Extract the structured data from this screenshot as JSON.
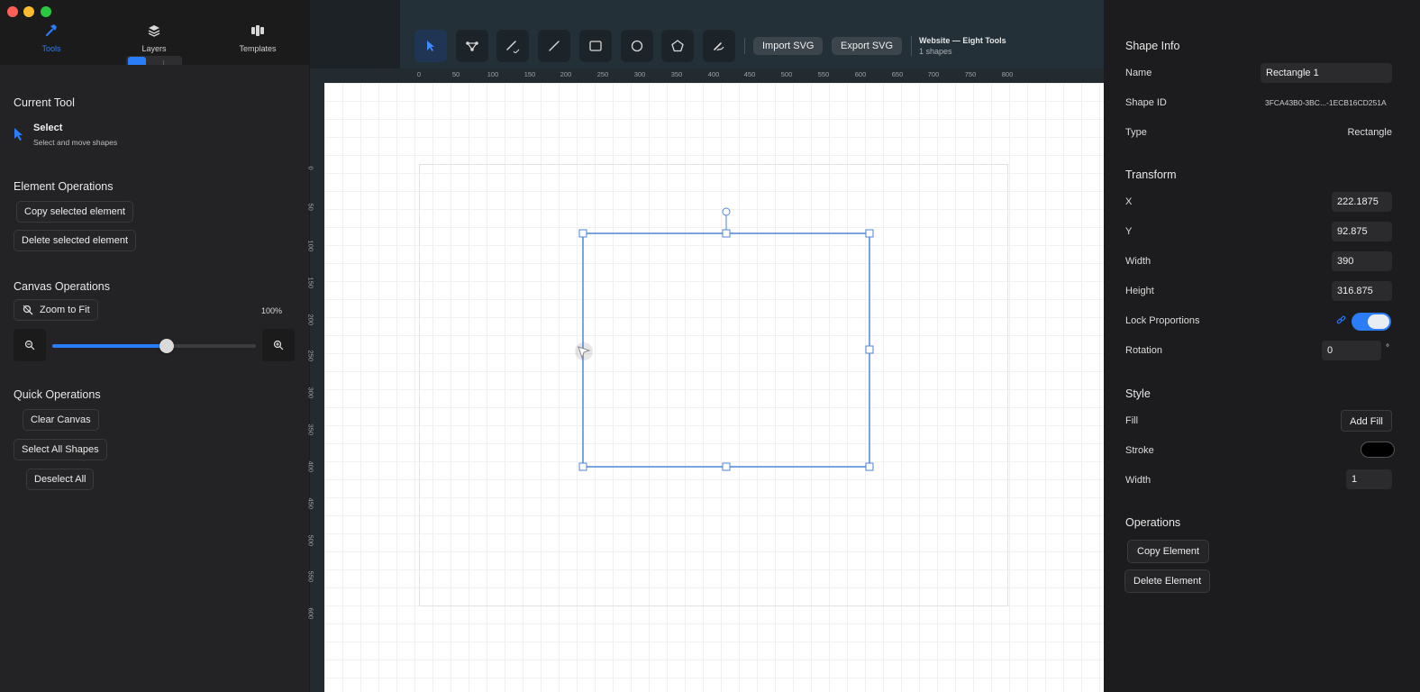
{
  "sidebar": {
    "tabs": [
      {
        "label": "Tools",
        "icon": "hammer-icon",
        "active": true
      },
      {
        "label": "Layers",
        "icon": "layers-icon",
        "active": false
      },
      {
        "label": "Templates",
        "icon": "templates-icon",
        "active": false
      }
    ],
    "current_tool": {
      "title": "Current Tool",
      "name": "Select",
      "description": "Select and move shapes",
      "icon": "cursor-arrow-icon"
    },
    "element_ops": {
      "title": "Element Operations",
      "copy_label": "Copy selected element",
      "delete_label": "Delete selected element"
    },
    "canvas_ops": {
      "title": "Canvas Operations",
      "zoom_fit_label": "Zoom to Fit",
      "zoom_value": "100%",
      "zoom_slider_fraction": 0.56
    },
    "quick_ops": {
      "title": "Quick Operations",
      "clear_label": "Clear Canvas",
      "select_all_label": "Select All Shapes",
      "deselect_label": "Deselect All"
    }
  },
  "toolbar": {
    "tools": [
      {
        "name": "select",
        "icon": "cursor-arrow-icon",
        "active": true
      },
      {
        "name": "node",
        "icon": "node-edit-icon",
        "active": false
      },
      {
        "name": "pen",
        "icon": "pen-icon",
        "active": false
      },
      {
        "name": "line",
        "icon": "line-icon",
        "active": false
      },
      {
        "name": "rectangle",
        "icon": "rectangle-icon",
        "active": false
      },
      {
        "name": "ellipse",
        "icon": "circle-icon",
        "active": false
      },
      {
        "name": "polygon",
        "icon": "pentagon-icon",
        "active": false
      },
      {
        "name": "freehand",
        "icon": "freehand-icon",
        "active": false
      }
    ],
    "import_label": "Import SVG",
    "export_label": "Export SVG",
    "doc_title": "Website — Eight Tools",
    "doc_subtitle": "1 shapes"
  },
  "rulers": {
    "horizontal": [
      "0",
      "50",
      "100",
      "150",
      "200",
      "250",
      "300",
      "350",
      "400",
      "450",
      "500",
      "550",
      "600",
      "650",
      "700",
      "750",
      "800"
    ],
    "vertical": [
      "0",
      "50",
      "100",
      "150",
      "200",
      "250",
      "300",
      "350",
      "400",
      "450",
      "500",
      "550",
      "600"
    ]
  },
  "inspector": {
    "shape_info": {
      "title": "Shape Info",
      "name_label": "Name",
      "name_value": "Rectangle 1",
      "id_label": "Shape ID",
      "id_value": "3FCA43B0-3BC...-1ECB16CD251A",
      "type_label": "Type",
      "type_value": "Rectangle"
    },
    "transform": {
      "title": "Transform",
      "x_label": "X",
      "x_value": "222.1875",
      "y_label": "Y",
      "y_value": "92.875",
      "width_label": "Width",
      "width_value": "390",
      "height_label": "Height",
      "height_value": "316.875",
      "lock_label": "Lock Proportions",
      "lock_on": true,
      "rotation_label": "Rotation",
      "rotation_value": "0",
      "rotation_unit": "°"
    },
    "style": {
      "title": "Style",
      "fill_label": "Fill",
      "add_fill_label": "Add Fill",
      "stroke_label": "Stroke",
      "stroke_color": "#000000",
      "width_label": "Width",
      "width_value": "1"
    },
    "operations": {
      "title": "Operations",
      "copy_label": "Copy Element",
      "delete_label": "Delete Element"
    }
  },
  "colors": {
    "accent": "#2a7cf7",
    "selection": "#4f86d6"
  }
}
